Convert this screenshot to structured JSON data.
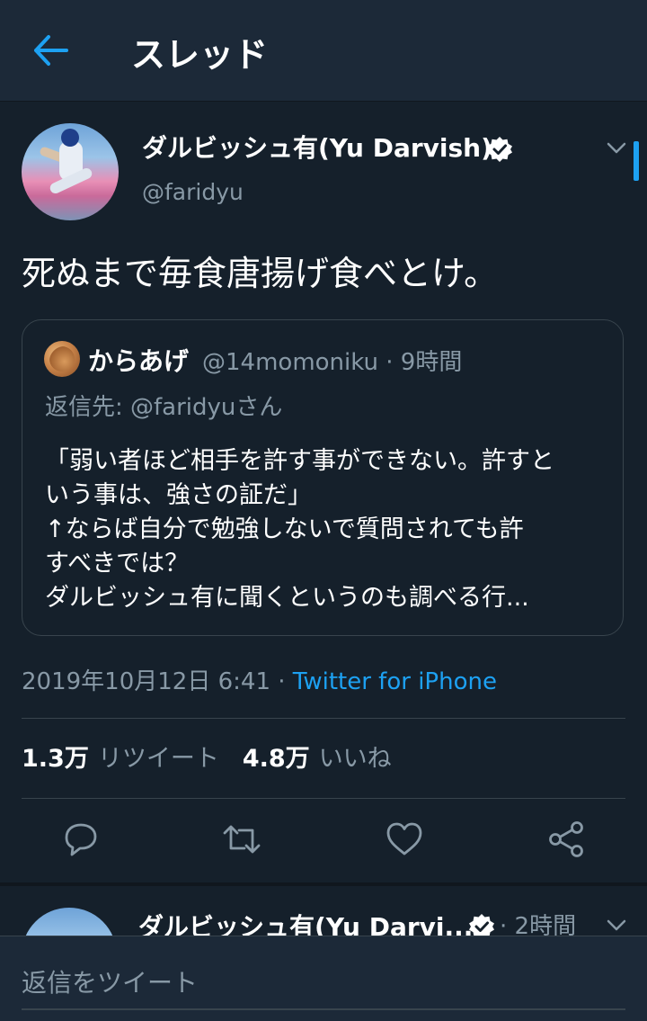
{
  "header": {
    "title": "スレッド"
  },
  "tweet": {
    "author_name": "ダルビッシュ有(Yu Darvish)",
    "handle": "@faridyu",
    "text": "死ぬまで毎食唐揚げ食べとけ。",
    "quoted": {
      "author_name": "からあげ",
      "meta": "@14momoniku · 9時間",
      "reply_to": "返信先: @faridyuさん",
      "lines": [
        "「弱い者ほど相手を許す事ができない。許すと",
        "いう事は、強さの証だ」",
        "↑ならば自分で勉強しないで質問されても許",
        "すべきでは？",
        "ダルビッシュ有に聞くというのも調べる行..."
      ]
    },
    "timestamp": "2019年10月12日 6:41 · ",
    "source": "Twitter for iPhone",
    "stats": {
      "retweets_count": "1.3万",
      "retweets_label": "リツイート",
      "likes_count": "4.8万",
      "likes_label": "いいね"
    }
  },
  "next_tweet": {
    "author_name": "ダルビッシュ有(Yu Darvi...",
    "time": "· 2時間"
  },
  "reply": {
    "placeholder": "返信をツイート"
  },
  "icons": {
    "back": "arrow-left-icon",
    "verified": "verified-badge-icon",
    "chevron": "chevron-down-icon",
    "reply": "reply-icon",
    "retweet": "retweet-icon",
    "like": "heart-icon",
    "share": "share-icon"
  },
  "colors": {
    "background": "#15202b",
    "header": "#1c2938",
    "accent": "#1da1f2",
    "muted": "#8899a6",
    "border": "#38444d"
  }
}
